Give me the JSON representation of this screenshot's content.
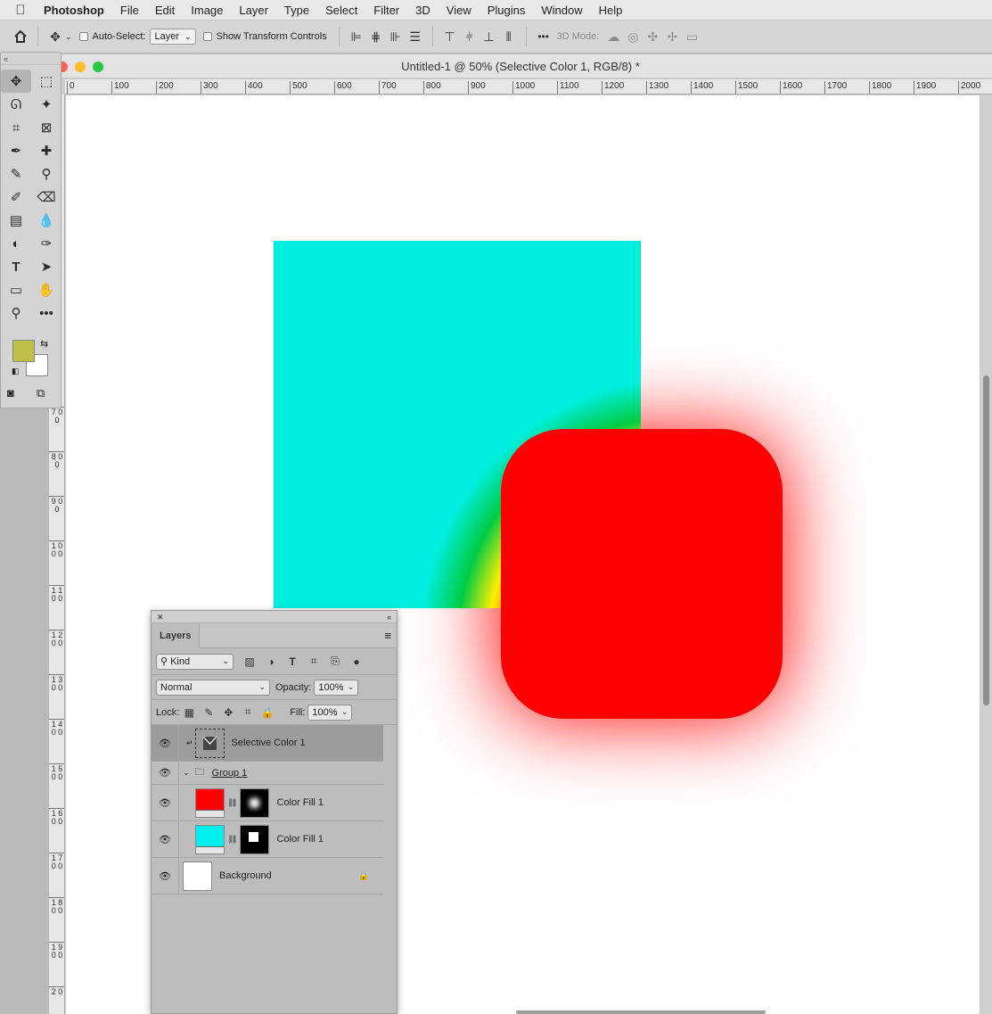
{
  "menubar": {
    "apple": "",
    "app": "Photoshop",
    "items": [
      "File",
      "Edit",
      "Image",
      "Layer",
      "Type",
      "Select",
      "Filter",
      "3D",
      "View",
      "Plugins",
      "Window",
      "Help"
    ]
  },
  "options": {
    "auto_select_label": "Auto-Select:",
    "auto_select_value": "Layer",
    "show_transform_label": "Show Transform Controls",
    "more": "•••",
    "mode_3d_label": "3D Mode:"
  },
  "document": {
    "title": "Untitled-1 @ 50% (Selective Color 1, RGB/8) *",
    "ruler_h": [
      "0",
      "100",
      "200",
      "300",
      "400",
      "500",
      "600",
      "700",
      "800",
      "900",
      "1000",
      "1100",
      "1200",
      "1300",
      "1400",
      "1500",
      "1600",
      "1700",
      "1800",
      "1900",
      "2000"
    ],
    "ruler_v": [
      "7 0 0",
      "8 0 0",
      "9 0 0",
      "1 0 0 0",
      "1 1 0 0",
      "1 2 0 0",
      "1 3 0 0",
      "1 4 0 0",
      "1 5 0 0",
      "1 6 0 0",
      "1 7 0 0",
      "1 8 0 0",
      "1 9 0 0",
      "2 0"
    ]
  },
  "colors": {
    "foreground": "#bfc04a",
    "background": "#ffffff",
    "cyan": "#00eedd",
    "red": "#ff0000"
  },
  "layers_panel": {
    "tab": "Layers",
    "kind_label": "Kind",
    "blend_mode": "Normal",
    "opacity_label": "Opacity:",
    "opacity_value": "100%",
    "lock_label": "Lock:",
    "fill_label": "Fill:",
    "fill_value": "100%",
    "layers": [
      {
        "name": "Selective Color 1",
        "type": "adjustment",
        "selected": true
      },
      {
        "name": "Group 1",
        "type": "group"
      },
      {
        "name": "Color Fill 1",
        "type": "fill",
        "color": "#ff0000",
        "mask": "blurred-square"
      },
      {
        "name": "Color Fill 1",
        "type": "fill",
        "color": "#00eeee",
        "mask": "small-square"
      },
      {
        "name": "Background",
        "type": "background",
        "locked": true
      }
    ]
  }
}
